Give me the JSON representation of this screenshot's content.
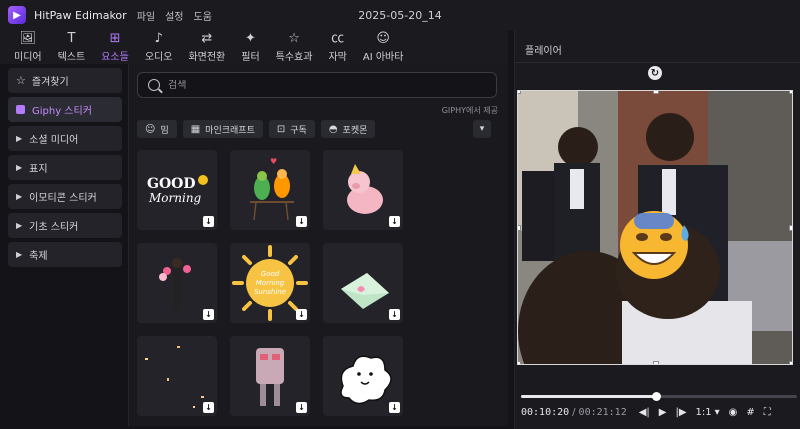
{
  "app": {
    "title": "HitPaw Edimakor",
    "menu": [
      "파일",
      "설정",
      "도움"
    ],
    "project_name": "2025-05-20_14",
    "accent_color": "#b37cff"
  },
  "toolbar": {
    "tabs": [
      {
        "label": "미디어",
        "icon": "media-icon",
        "glyph": "🖼"
      },
      {
        "label": "텍스트",
        "icon": "text-icon",
        "glyph": "T"
      },
      {
        "label": "요소들",
        "icon": "elements-icon",
        "glyph": "⊞",
        "active": true
      },
      {
        "label": "오디오",
        "icon": "music-icon",
        "glyph": "♪"
      },
      {
        "label": "화면전환",
        "icon": "transition-icon",
        "glyph": "⇄"
      },
      {
        "label": "필터",
        "icon": "filter-icon",
        "glyph": "✦"
      },
      {
        "label": "특수효과",
        "icon": "effects-icon",
        "glyph": "☆"
      },
      {
        "label": "자막",
        "icon": "subtitle-icon",
        "glyph": "㏄"
      },
      {
        "label": "AI 아바타",
        "icon": "avatar-icon",
        "glyph": "☺"
      }
    ]
  },
  "categories": [
    {
      "label": "즐겨찾기",
      "type": "favorites"
    },
    {
      "label": "Giphy 스티커",
      "type": "active"
    },
    {
      "label": "소셜 미디어",
      "type": "group"
    },
    {
      "label": "표지",
      "type": "group"
    },
    {
      "label": "이모티콘 스티커",
      "type": "group"
    },
    {
      "label": "기초 스티커",
      "type": "group"
    },
    {
      "label": "축제",
      "type": "group"
    }
  ],
  "search": {
    "placeholder": "검색"
  },
  "giphy_credit": "GIPHY에서 제공",
  "chips": [
    {
      "label": "밈",
      "icon": "smile-icon",
      "glyph": "☺"
    },
    {
      "label": "마인크래프트",
      "icon": "minecraft-icon",
      "glyph": "▦"
    },
    {
      "label": "구독",
      "icon": "bookmark-icon",
      "glyph": "⊡"
    },
    {
      "label": "포켓몬",
      "icon": "pokeball-icon",
      "glyph": "◓"
    }
  ],
  "sticker_labels": {
    "good_morning": "GOOD",
    "good_morning_script": "Morning",
    "sunshine_line1": "Good",
    "sunshine_line2": "Morning",
    "sunshine_line3": "Sunshine"
  },
  "player": {
    "title": "플레이어",
    "current_time": "00:10:20",
    "total_time": "00:21:12",
    "speed": "1:1",
    "progress": 0.49
  }
}
